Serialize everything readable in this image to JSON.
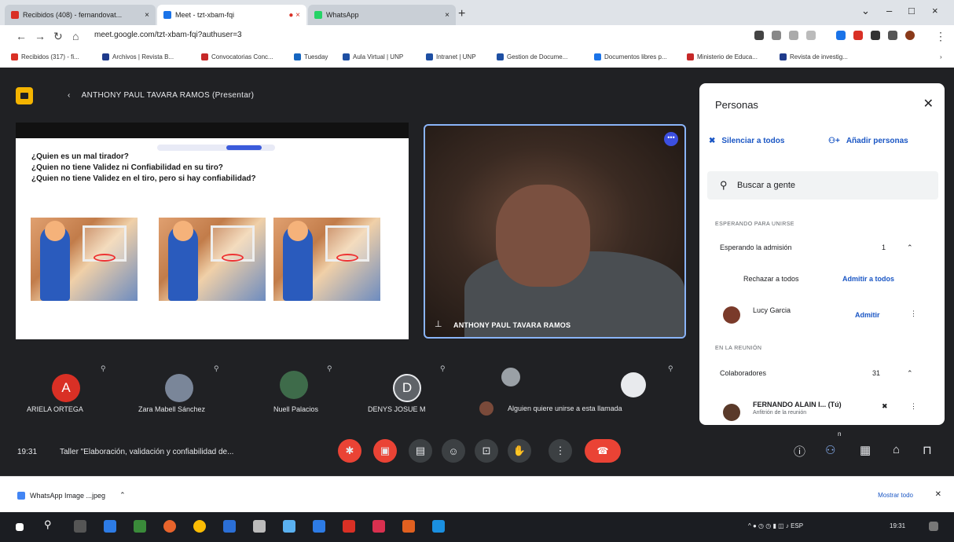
{
  "browser": {
    "tabs": [
      {
        "title": "Recibidos (408) - fernandovat...",
        "color": "#d93025"
      },
      {
        "title": "Meet - tzt-xbam-fqi",
        "color": "#1a73e8"
      },
      {
        "title": "WhatsApp",
        "color": "#25d366"
      }
    ],
    "url": "meet.google.com/tzt-xbam-fqi?authuser=3",
    "bookmarks": [
      {
        "label": "Recibidos (317) - fi...",
        "color": "#d93025"
      },
      {
        "label": "Archivos | Revista B...",
        "color": "#1f3b8c"
      },
      {
        "label": "Convocatorias Conc...",
        "color": "#c62828"
      },
      {
        "label": "Tuesday",
        "color": "#1565c0"
      },
      {
        "label": "Aula Virtual | UNP",
        "color": "#1e4fa3"
      },
      {
        "label": "Intranet | UNP",
        "color": "#1e4fa3"
      },
      {
        "label": "Gestion de Docume...",
        "color": "#1e4fa3"
      },
      {
        "label": "Documentos libres p...",
        "color": "#1a73e8"
      },
      {
        "label": "Ministerio de Educa...",
        "color": "#c62828"
      },
      {
        "label": "Revista de investig...",
        "color": "#1f3b8c"
      }
    ]
  },
  "meet": {
    "presenter": "ANTHONY PAUL TAVARA RAMOS (Presentar)",
    "slide": {
      "questions": [
        "¿Quien es un mal tirador?",
        "¿Quien no tiene Validez ni Confiabilidad en su tiro?",
        "¿Quien no tiene Validez en el tiro, pero si hay confiabilidad?"
      ]
    },
    "video_name": "ANTHONY PAUL TAVARA RAMOS",
    "participants": [
      {
        "name": "ARIELA ORTEGA",
        "initial": "A",
        "color": "#d93025"
      },
      {
        "name": "Zara Mabell Sánchez",
        "initial": "",
        "color": "#7a8699"
      },
      {
        "name": "Nuell Palacios",
        "initial": "",
        "color": "#3e6b4a"
      },
      {
        "name": "DENYS JOSUE M",
        "initial": "D",
        "color": "#5f6368"
      },
      {
        "name": "",
        "initial": "",
        "color": "#9aa0a6"
      }
    ],
    "knock_text": "Alguien quiere unirse a esta llamada",
    "time": "19:31",
    "meeting_title": "Taller \"Elaboración, validación y confiabilidad de...",
    "people_badge": "n"
  },
  "panel": {
    "title": "Personas",
    "mute_all": "Silenciar a todos",
    "add_people": "Añadir personas",
    "search_placeholder": "Buscar a gente",
    "waiting_section": "ESPERANDO PARA UNIRSE",
    "waiting_label": "Esperando la admisión",
    "waiting_count": "1",
    "reject_all": "Rechazar a todos",
    "admit_all": "Admitir a todos",
    "waiting_person": "Lucy Garcia",
    "admit": "Admitir",
    "in_meeting_section": "EN LA REUNIÓN",
    "collaborators_label": "Colaboradores",
    "collaborators_count": "31",
    "host_name": "FERNANDO ALAIN I... (Tú)",
    "host_role": "Anfitrión de la reunión"
  },
  "download": {
    "file": "WhatsApp Image ...jpeg",
    "show_all": "Mostrar todo"
  },
  "taskbar": {
    "tray_text": "19:31"
  }
}
